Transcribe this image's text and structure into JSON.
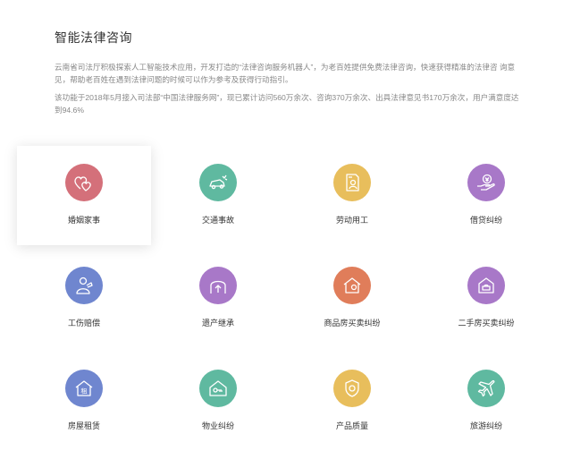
{
  "header": {
    "title": "智能法律咨询"
  },
  "intro": {
    "paragraph1": "云南省司法厅积极探索人工智能技术应用，开发打造的“法律咨询服务机器人”，为老百姓提供免费法律咨询，快速获得精准的法律咨 询意见，帮助老百姓在遇到法律问题的时候可以作为参考及获得行动指引。",
    "paragraph2": "该功能于2018年5月接入司法部“中国法律服务网”，现已累计访问560万余次、咨询370万余次、出具法律意见书170万余次，用户满意度达到94.6%"
  },
  "categories": [
    {
      "label": "婚姻家事",
      "icon": "hearts-icon",
      "color": "#d4707a",
      "active": true
    },
    {
      "label": "交通事故",
      "icon": "car-crash-icon",
      "color": "#5fb9a0",
      "active": false
    },
    {
      "label": "劳动用工",
      "icon": "worker-document-icon",
      "color": "#e8be5c",
      "active": false
    },
    {
      "label": "借贷纠纷",
      "icon": "money-hand-icon",
      "color": "#a878c8",
      "active": false
    },
    {
      "label": "工伤赔偿",
      "icon": "injured-worker-icon",
      "color": "#6f86cf",
      "active": false
    },
    {
      "label": "遗产继承",
      "icon": "inheritance-icon",
      "color": "#a878c8",
      "active": false
    },
    {
      "label": "商品房买卖纠纷",
      "icon": "house-buy-icon",
      "color": "#e07d5a",
      "active": false
    },
    {
      "label": "二手房买卖纠纷",
      "icon": "secondhand-house-icon",
      "color": "#a878c8",
      "active": false
    },
    {
      "label": "房屋租赁",
      "icon": "house-rent-icon",
      "color": "#6f86cf",
      "active": false
    },
    {
      "label": "物业纠纷",
      "icon": "property-key-icon",
      "color": "#5fb9a0",
      "active": false
    },
    {
      "label": "产品质量",
      "icon": "quality-badge-icon",
      "color": "#e8be5c",
      "active": false
    },
    {
      "label": "旅游纠纷",
      "icon": "airplane-icon",
      "color": "#5fb9a0",
      "active": false
    }
  ]
}
